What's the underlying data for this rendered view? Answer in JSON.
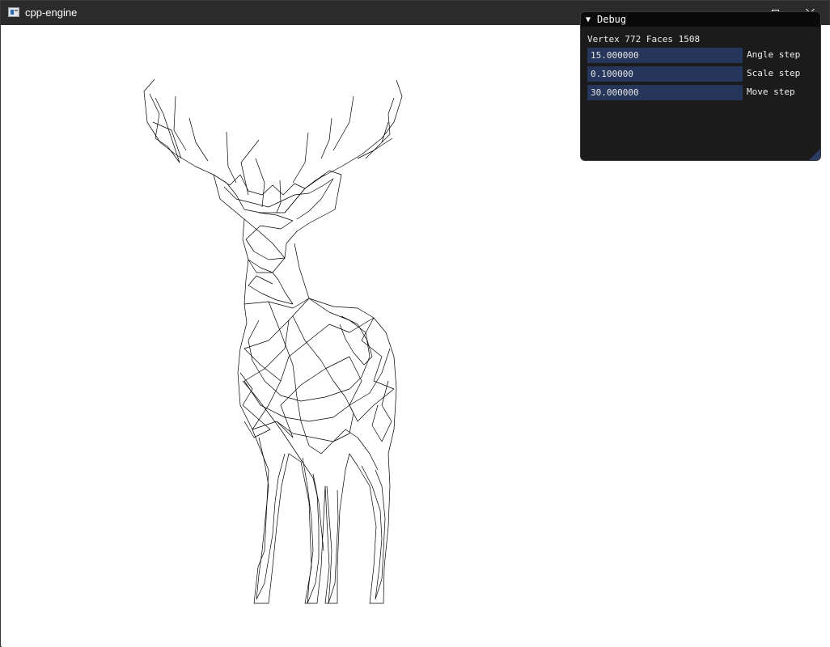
{
  "window": {
    "title": "cpp-engine",
    "app_icon": "app-window-icon",
    "controls": {
      "minimize": "minimize-icon",
      "maximize": "maximize-icon",
      "close": "close-icon"
    }
  },
  "viewport": {
    "content": "wireframe-deer-mesh",
    "line_color": "#000000",
    "background": "#ffffff"
  },
  "debug_panel": {
    "title": "Debug",
    "collapse_icon": "▼",
    "stats_text": "Vertex 772 Faces 1508",
    "fields": [
      {
        "value": "15.000000",
        "label": "Angle step"
      },
      {
        "value": "0.100000",
        "label": "Scale step"
      },
      {
        "value": "30.000000",
        "label": "Move step"
      }
    ]
  },
  "colors": {
    "titlebar": "#2b2b2b",
    "panel_bg": "#1b1b1b",
    "input_bg": "#25365a"
  }
}
